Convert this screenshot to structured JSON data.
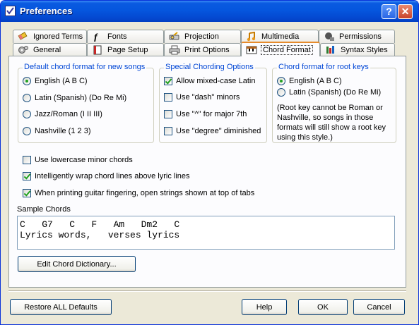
{
  "window": {
    "title": "Preferences"
  },
  "titlebar": {
    "help": "?",
    "close": "✕"
  },
  "tabs_row1": [
    {
      "label": "Ignored Terms",
      "icon": "eraser-icon"
    },
    {
      "label": "Fonts",
      "icon": "font-icon"
    },
    {
      "label": "Projection",
      "icon": "projector-icon"
    },
    {
      "label": "Multimedia",
      "icon": "music-note-icon"
    },
    {
      "label": "Permissions",
      "icon": "lock-icon"
    }
  ],
  "tabs_row2": [
    {
      "label": "General",
      "icon": "gears-icon"
    },
    {
      "label": "Page Setup",
      "icon": "page-setup-icon"
    },
    {
      "label": "Print Options",
      "icon": "printer-icon"
    },
    {
      "label": "Chord Format",
      "icon": "piano-icon",
      "active": true
    },
    {
      "label": "Syntax Styles",
      "icon": "palette-icon"
    }
  ],
  "default_format": {
    "title": "Default chord format for new songs",
    "options": [
      {
        "label": "English   (A B C)",
        "selected": true
      },
      {
        "label": "Latin   (Spanish) (Do Re Mi)",
        "selected": false
      },
      {
        "label": "Jazz/Roman (I II III)",
        "selected": false
      },
      {
        "label": "Nashville (1 2 3)",
        "selected": false
      }
    ]
  },
  "special": {
    "title": "Special Chording Options",
    "options": [
      {
        "label": "Allow mixed-case Latin",
        "checked": true
      },
      {
        "label": "Use \"dash\" minors",
        "checked": false
      },
      {
        "label": "Use \"^\" for major 7th",
        "checked": false
      },
      {
        "label": "Use \"degree\" diminished",
        "checked": false
      }
    ]
  },
  "root_keys": {
    "title": "Chord format for root keys",
    "options": [
      {
        "label": "English   (A B C)",
        "selected": true
      },
      {
        "label": "Latin   (Spanish) (Do Re Mi)",
        "selected": false
      }
    ],
    "note": "(Root key cannot be Roman or Nashville, so songs in those formats will still show a root key using this style.)"
  },
  "general_options": [
    {
      "label": "Use lowercase minor chords",
      "checked": false
    },
    {
      "label": "Intelligently wrap chord lines above lyric lines",
      "checked": true
    },
    {
      "label": "When printing guitar fingering, open strings shown at top of tabs",
      "checked": true
    }
  ],
  "sample": {
    "label": "Sample Chords",
    "chord_line": "C   G7   C   F   Am   Dm2   C",
    "lyric_line": "Lyrics words,   verses lyrics"
  },
  "buttons": {
    "edit_dictionary": "Edit Chord Dictionary...",
    "restore_defaults": "Restore ALL Defaults",
    "help": "Help",
    "ok": "OK",
    "cancel": "Cancel"
  },
  "colors": {
    "title_bar": "#0556de",
    "group_title": "#0046d5",
    "active_tab_accent": "#e68b2c",
    "check_mark": "#21a121"
  }
}
